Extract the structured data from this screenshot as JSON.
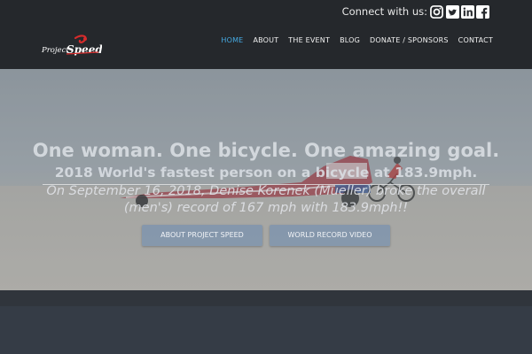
{
  "topbar": {
    "connect_label": "Connect with us:",
    "social": [
      "instagram-icon",
      "twitter-icon",
      "linkedin-icon",
      "facebook-icon"
    ]
  },
  "header": {
    "logo_text_1": "Project",
    "logo_text_2": "Speed",
    "nav": [
      {
        "label": "HOME",
        "active": true
      },
      {
        "label": "ABOUT"
      },
      {
        "label": "THE EVENT"
      },
      {
        "label": "BLOG"
      },
      {
        "label": "DONATE / SPONSORS"
      },
      {
        "label": "CONTACT"
      }
    ]
  },
  "hero": {
    "headline": "One woman. One bicycle. One amazing goal.",
    "subheadline": "2018 World's fastest person on a bicycle at 183.9mph.",
    "description": "On September 16, 2018, Denise Korenek (Mueller) broke the overall (men's) record of 167 mph with 183.9mph!!",
    "buttons": [
      "ABOUT PROJECT SPEED",
      "WORLD RECORD VIDEO"
    ]
  },
  "colors": {
    "accent": "#45a9e1",
    "header_bg": "#25282c",
    "button_bg": "#7891af"
  }
}
